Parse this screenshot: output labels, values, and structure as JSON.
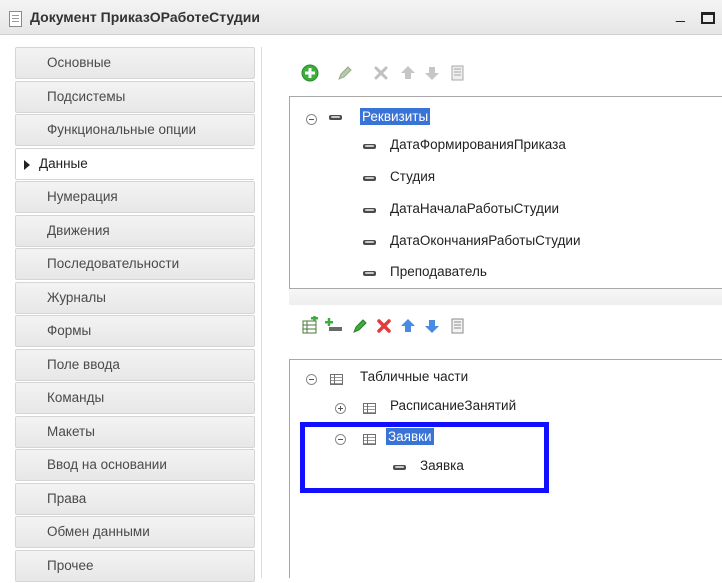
{
  "window": {
    "title": "Документ ПриказОРаботеСтудии"
  },
  "sidebar": {
    "items": [
      {
        "label": "Основные"
      },
      {
        "label": "Подсистемы"
      },
      {
        "label": "Функциональные опции"
      },
      {
        "label": "Данные",
        "active": true
      },
      {
        "label": "Нумерация"
      },
      {
        "label": "Движения"
      },
      {
        "label": "Последовательности"
      },
      {
        "label": "Журналы"
      },
      {
        "label": "Формы"
      },
      {
        "label": "Поле ввода"
      },
      {
        "label": "Команды"
      },
      {
        "label": "Макеты"
      },
      {
        "label": "Ввод на основании"
      },
      {
        "label": "Права"
      },
      {
        "label": "Обмен данными"
      },
      {
        "label": "Прочее"
      }
    ]
  },
  "attributes": {
    "root": "Реквизиты",
    "items": [
      "ДатаФормированияПриказа",
      "Студия",
      "ДатаНачалаРаботыСтудии",
      "ДатаОкончанияРаботыСтудии",
      "Преподаватель"
    ]
  },
  "tabular_sections": {
    "root": "Табличные части",
    "items": [
      {
        "label": "РасписаниеЗанятий"
      },
      {
        "label": "Заявки",
        "children": [
          "Заявка"
        ]
      }
    ]
  },
  "colors": {
    "selection": "#3a73d6",
    "highlight_box": "#1010ff",
    "add_green": "#3cae3c",
    "delete_red": "#e03c3c",
    "move_blue": "#4a8ae0"
  }
}
